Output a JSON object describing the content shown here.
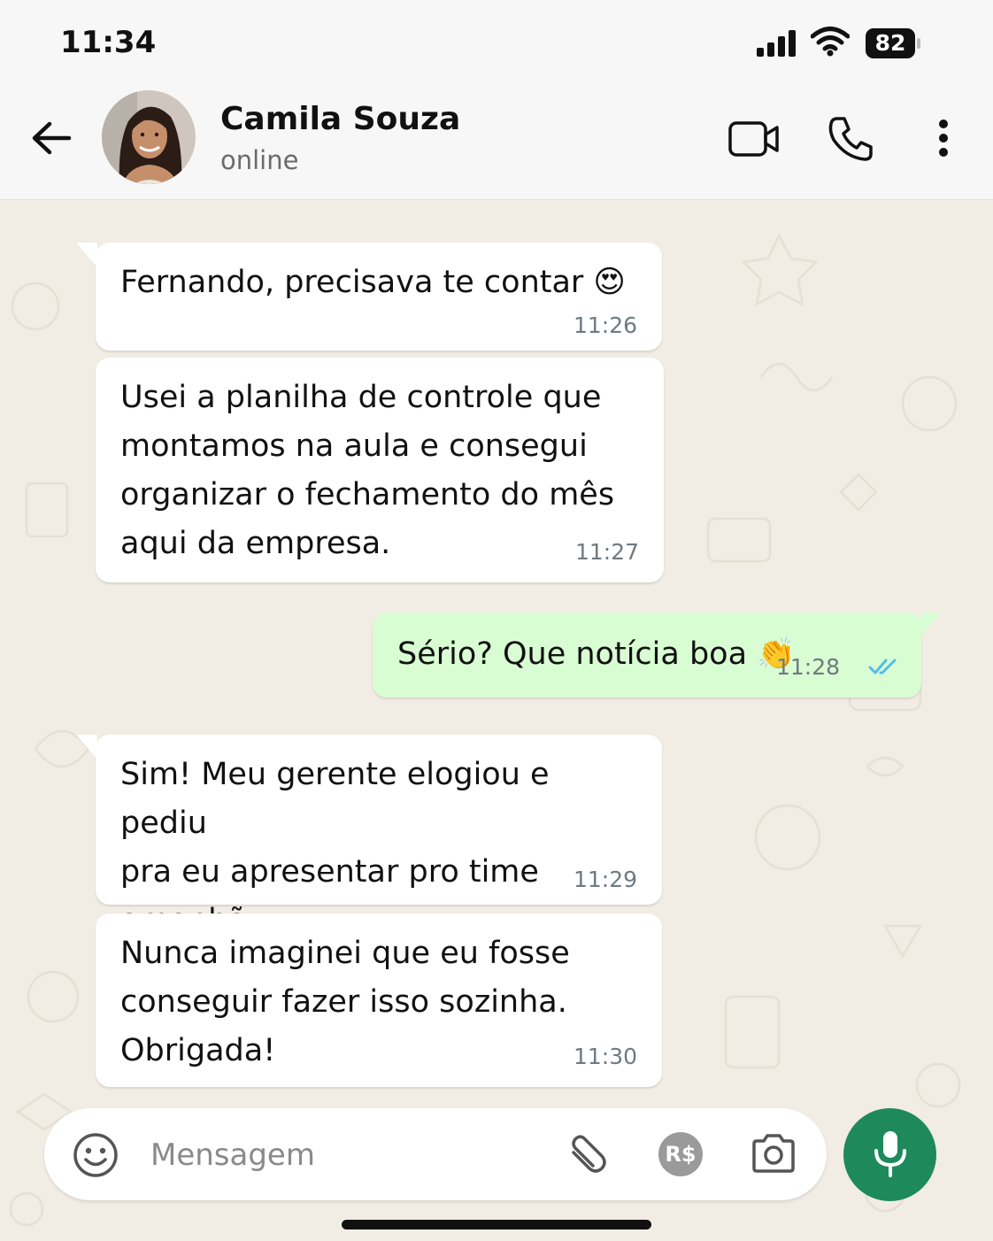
{
  "status_bar": {
    "time": "11:34",
    "battery_level": "82",
    "icons": [
      "signal-icon",
      "wifi-icon",
      "battery-icon"
    ]
  },
  "header": {
    "contact_name": "Camila Souza",
    "contact_status": "online",
    "icons": [
      "back-arrow-icon",
      "video-call-icon",
      "phone-call-icon",
      "more-options-icon"
    ]
  },
  "messages": [
    {
      "direction": "incoming",
      "text": "Fernando, precisava te contar 😍",
      "time": "11:26"
    },
    {
      "direction": "incoming",
      "text": "Usei a planilha de controle que\nmontamos na aula e consegui\norganizar o fechamento do mês\naqui da empresa.",
      "time": "11:27"
    },
    {
      "direction": "outgoing",
      "text": "Sério? Que notícia boa 👏",
      "time": "11:28",
      "status": "read"
    },
    {
      "direction": "incoming",
      "text": "Sim! Meu gerente elogiou e pediu\npra eu apresentar pro time amanhã\n🙏",
      "time": "11:29"
    },
    {
      "direction": "incoming",
      "text": "Nunca imaginei que eu fosse\nconseguir fazer isso sozinha.\nObrigada!",
      "time": "11:30"
    }
  ],
  "input_bar": {
    "placeholder": "Mensagem",
    "value": "",
    "payment_label": "R$",
    "icons": [
      "emoji-icon",
      "attach-icon",
      "payment-icon",
      "camera-icon",
      "microphone-icon"
    ]
  },
  "colors": {
    "chat_background": "#f1ece4",
    "outgoing_bubble": "#d9fdd3",
    "incoming_bubble": "#ffffff",
    "mic_button": "#1e8a5c",
    "read_ticks": "#53bdeb"
  }
}
